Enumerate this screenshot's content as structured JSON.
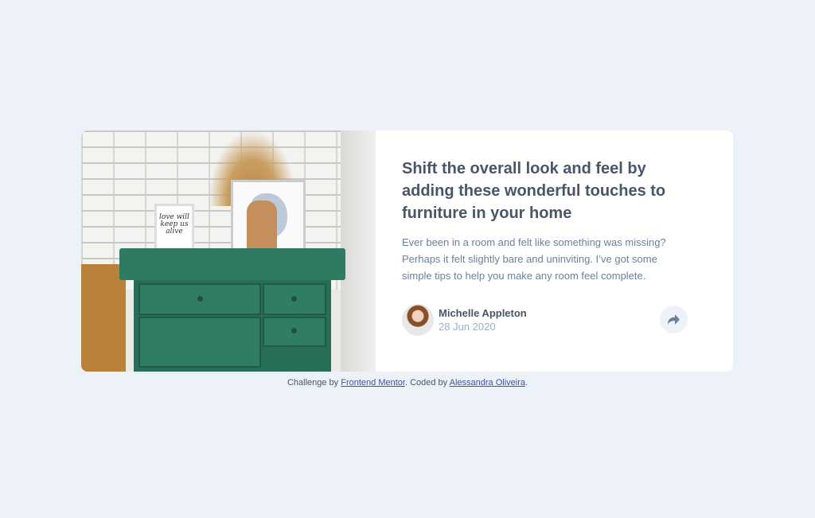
{
  "article": {
    "title": "Shift the overall look and feel by adding these wonderful touches to furniture in your home",
    "description": "Ever been in a room and felt like something was missing? Perhaps it felt slightly bare and uninviting. I’ve got some simple tips to help you make any room feel complete.",
    "frame_text": "love will keep us alive",
    "share_icon": "share-arrow-icon"
  },
  "author": {
    "name": "Michelle Appleton",
    "date": "28 Jun 2020"
  },
  "footer": {
    "prefix": "Challenge by ",
    "link1": "Frontend Mentor",
    "middle": ". Coded by ",
    "link2": "Alessandra Oliveira",
    "suffix": "."
  },
  "colors": {
    "background": "#ecf2f8",
    "title": "#48556a",
    "body": "#6e8098",
    "muted": "#9daec2"
  }
}
